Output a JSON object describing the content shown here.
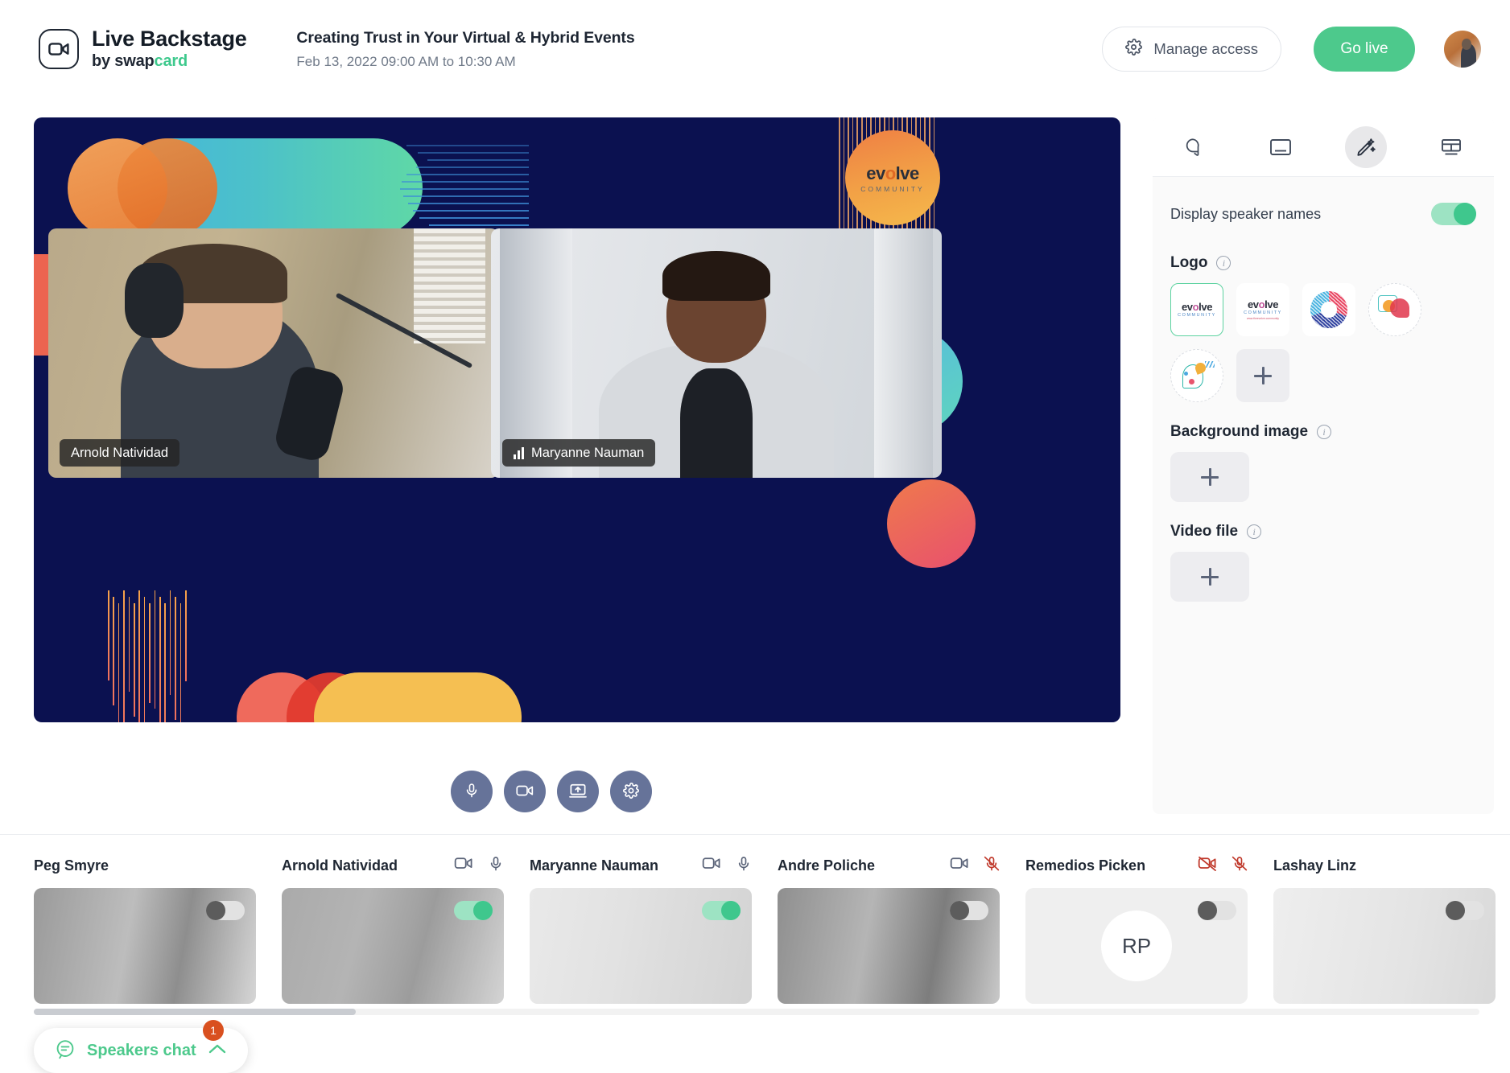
{
  "header": {
    "brand_title": "Live Backstage",
    "brand_sub_prefix": "by swap",
    "brand_sub_tail": "card",
    "session_title": "Creating Trust in Your Virtual & Hybrid Events",
    "session_time": "Feb 13, 2022 09:00 AM to 10:30 AM",
    "manage_access_label": "Manage access",
    "go_live_label": "Go live"
  },
  "stage": {
    "logo_watermark_word": "evolve",
    "logo_watermark_sub": "COMMUNITY",
    "tiles": [
      {
        "speaker": "Arnold Natividad",
        "speaking": false
      },
      {
        "speaker": "Maryanne Nauman",
        "speaking": true
      }
    ],
    "controls": [
      {
        "name": "microphone",
        "label": "Microphone"
      },
      {
        "name": "camera",
        "label": "Camera"
      },
      {
        "name": "share-screen",
        "label": "Share screen"
      },
      {
        "name": "settings",
        "label": "Settings"
      }
    ]
  },
  "panel": {
    "tabs": [
      {
        "name": "chat",
        "label": "Chat",
        "active": false
      },
      {
        "name": "layout",
        "label": "Layout",
        "active": false
      },
      {
        "name": "branding",
        "label": "Branding",
        "active": true
      },
      {
        "name": "grid",
        "label": "Grid",
        "active": false
      }
    ],
    "display_speaker_names_label": "Display speaker names",
    "display_speaker_names_on": true,
    "logo_section_title": "Logo",
    "background_section_title": "Background image",
    "video_section_title": "Video file",
    "logos": [
      {
        "name": "evolve-community-boxed",
        "selected": true,
        "word": "evolve",
        "community": "COMMUNITY"
      },
      {
        "name": "evolve-community-url",
        "selected": false,
        "word": "evolve",
        "community": "COMMUNITY",
        "url": "www.theevolve.community"
      },
      {
        "name": "striped-ring",
        "selected": false
      },
      {
        "name": "speech-bubbles",
        "selected": false
      },
      {
        "name": "head-idea",
        "selected": false
      }
    ],
    "add_label": "+"
  },
  "strip": {
    "speakers": [
      {
        "name": "Peg Smyre",
        "camera": "none",
        "mic": "none",
        "toggle": "off",
        "avatar": "photo",
        "photo": "peg"
      },
      {
        "name": "Arnold Natividad",
        "camera": "on",
        "mic": "on",
        "toggle": "on",
        "avatar": "photo",
        "photo": "arnold"
      },
      {
        "name": "Maryanne Nauman",
        "camera": "on",
        "mic": "on",
        "toggle": "on",
        "avatar": "photo",
        "photo": "maryanne"
      },
      {
        "name": "Andre Poliche",
        "camera": "on",
        "mic": "muted",
        "toggle": "off",
        "avatar": "photo",
        "photo": "andre"
      },
      {
        "name": "Remedios Picken",
        "camera": "muted",
        "mic": "muted",
        "toggle": "off",
        "avatar": "initials",
        "initials": "RP"
      },
      {
        "name": "Lashay Linz",
        "camera": "none",
        "mic": "none",
        "toggle": "off",
        "avatar": "photo",
        "photo": "lashay"
      }
    ]
  },
  "chat": {
    "label": "Speakers chat",
    "unread_count": "1"
  },
  "colors": {
    "accent_green": "#4dc98c",
    "stage_navy": "#0b1150",
    "badge_orange": "#d9501f",
    "control_slate": "#667399",
    "muted_red": "#c0392b"
  }
}
